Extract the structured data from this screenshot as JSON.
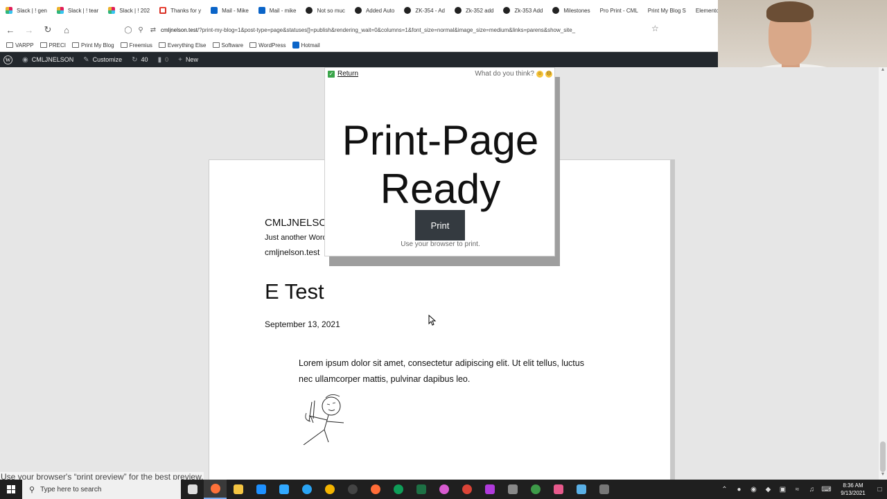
{
  "tabs": [
    {
      "label": "Slack | ! gen",
      "icon": "slack"
    },
    {
      "label": "Slack | ! tear",
      "icon": "slack"
    },
    {
      "label": "Slack | ! 202",
      "icon": "slack"
    },
    {
      "label": "Thanks for y",
      "icon": "gmail"
    },
    {
      "label": "Mail - Mike",
      "icon": "outlook"
    },
    {
      "label": "Mail - mike",
      "icon": "outlook"
    },
    {
      "label": "Not so muc",
      "icon": "github"
    },
    {
      "label": "Added Auto",
      "icon": "github"
    },
    {
      "label": "ZK-354 - Ad",
      "icon": "github"
    },
    {
      "label": "Zk-352 add",
      "icon": "github"
    },
    {
      "label": "Zk-353 Add",
      "icon": "github"
    },
    {
      "label": "Milestones",
      "icon": "github"
    },
    {
      "label": "Pro Print - CML",
      "icon": "none"
    },
    {
      "label": "Print My Blog S",
      "icon": "none"
    },
    {
      "label": "Elementor",
      "icon": "none"
    }
  ],
  "url": {
    "host": "cmljnelson.test",
    "path": "/?print-my-blog=1&post-type=page&statuses[]=publish&rendering_wait=0&columns=1&font_size=normal&image_size=medium&links=parens&show_site_"
  },
  "bookmarks": [
    {
      "label": "VARPP",
      "icon": "folder"
    },
    {
      "label": "PRECI",
      "icon": "folder"
    },
    {
      "label": "Print My Blog",
      "icon": "folder"
    },
    {
      "label": "Freemius",
      "icon": "folder"
    },
    {
      "label": "Everything Else",
      "icon": "folder"
    },
    {
      "label": "Software",
      "icon": "folder"
    },
    {
      "label": "WordPress",
      "icon": "folder"
    },
    {
      "label": "Hotmail",
      "icon": "outlook"
    }
  ],
  "adminbar": {
    "site": "CMLJNELSON",
    "customize": "Customize",
    "updates": "40",
    "comments": "0",
    "new": "New"
  },
  "panel": {
    "return_label": "Return",
    "feedback_label": "What do you think?",
    "headline": "Print-Page Ready",
    "print_button": "Print",
    "hint": "Use your browser to print."
  },
  "page": {
    "site_title": "CMLJNELSON",
    "tagline": "Just another WordPress site",
    "site_url": "cmljnelson.test",
    "post_title": "E Test",
    "post_date": "September 13, 2021",
    "body": "Lorem ipsum dolor sit amet, consectetur adipiscing elit. Ut elit tellus, luctus nec ullamcorper mattis, pulvinar dapibus leo."
  },
  "status_text": "Use your browser's “print preview” for the best preview.",
  "taskbar": {
    "search_placeholder": "Type here to search",
    "time": "8:36 AM",
    "date": "9/13/2021",
    "apps": [
      "task-view",
      "firefox",
      "file-explorer",
      "edge-legacy",
      "photoshop",
      "uplay",
      "chrome-canary",
      "obs",
      "postman",
      "edge",
      "excel",
      "itunes",
      "chrome",
      "phpstorm",
      "books",
      "hs",
      "notepad",
      "network",
      "misc"
    ]
  },
  "colors": {
    "adminbar": "#23282d",
    "print_button": "#343a40",
    "taskbar": "#1f1f1f"
  }
}
